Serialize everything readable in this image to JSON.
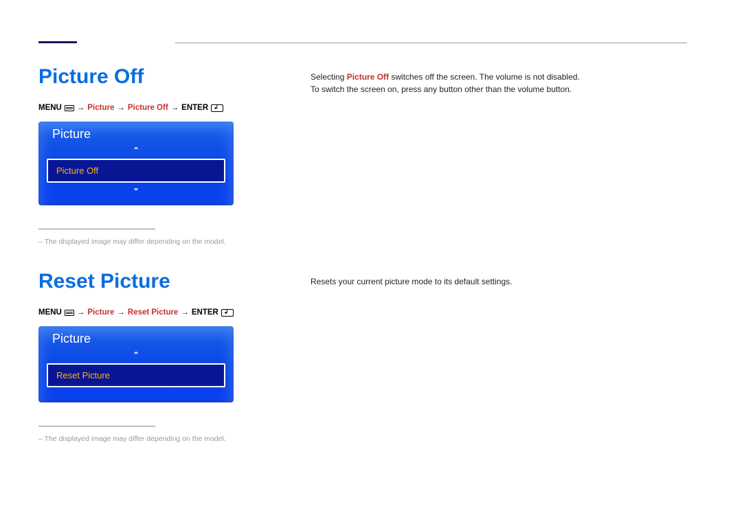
{
  "sections": {
    "s1": {
      "title": "Picture Off",
      "breadcrumb": {
        "menu": "MENU",
        "l1": "Picture",
        "l2": "Picture Off",
        "enter": "ENTER",
        "arrow": " → "
      },
      "menu": {
        "header": "Picture",
        "item": "Picture Off"
      },
      "footnote": "The displayed image may differ depending on the model.",
      "desc": {
        "pre": "Selecting ",
        "hl": "Picture Off",
        "post": " switches off the screen. The volume is not disabled.",
        "line2": "To switch the screen on, press any button other than the volume button."
      }
    },
    "s2": {
      "title": "Reset Picture",
      "breadcrumb": {
        "menu": "MENU",
        "l1": "Picture",
        "l2": "Reset Picture",
        "enter": "ENTER",
        "arrow": " → "
      },
      "menu": {
        "header": "Picture",
        "item": "Reset Picture"
      },
      "footnote": "The displayed image may differ depending on the model.",
      "desc": {
        "text": "Resets your current picture mode to its default settings."
      }
    }
  }
}
